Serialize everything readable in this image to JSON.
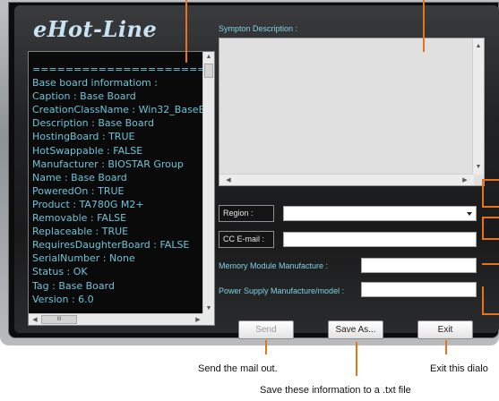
{
  "app": {
    "title": "eHot-Line"
  },
  "info_list": {
    "lines": [
      "=========================",
      "Base board informatiom :",
      "Caption : Base Board",
      "CreationClassName : Win32_BaseB",
      "Description : Base Board",
      "HostingBoard : TRUE",
      "HotSwappable : FALSE",
      "Manufacturer : BIOSTAR Group",
      "Name : Base Board",
      "PoweredOn : TRUE",
      "Product : TA780G M2+",
      "Removable : FALSE",
      "Replaceable : TRUE",
      "RequiresDaughterBoard : FALSE",
      "SerialNumber : None",
      "Status : OK",
      "Tag : Base Board",
      "Version : 6.0"
    ],
    "hscroll_thumb": "III"
  },
  "form": {
    "description_label": "Sympton Description :",
    "description_value": "",
    "region_label": "Region :",
    "region_value": "",
    "cc_email_label": "CC E-mail :",
    "cc_email_value": "",
    "memory_label": "Memory Module  Manufacture  :",
    "memory_value": "",
    "power_label": "Power Supply Manufacture/model  :",
    "power_value": ""
  },
  "buttons": {
    "send": "Send",
    "save_as": "Save As...",
    "exit": "Exit"
  },
  "callouts": {
    "send": "Send the mail out.",
    "save": "Save these information to a .txt file",
    "exit": "Exit this dialo"
  },
  "colors": {
    "callout_line": "#e8731b",
    "info_text": "#6fc3d8",
    "label_text": "#7fd0e6"
  }
}
